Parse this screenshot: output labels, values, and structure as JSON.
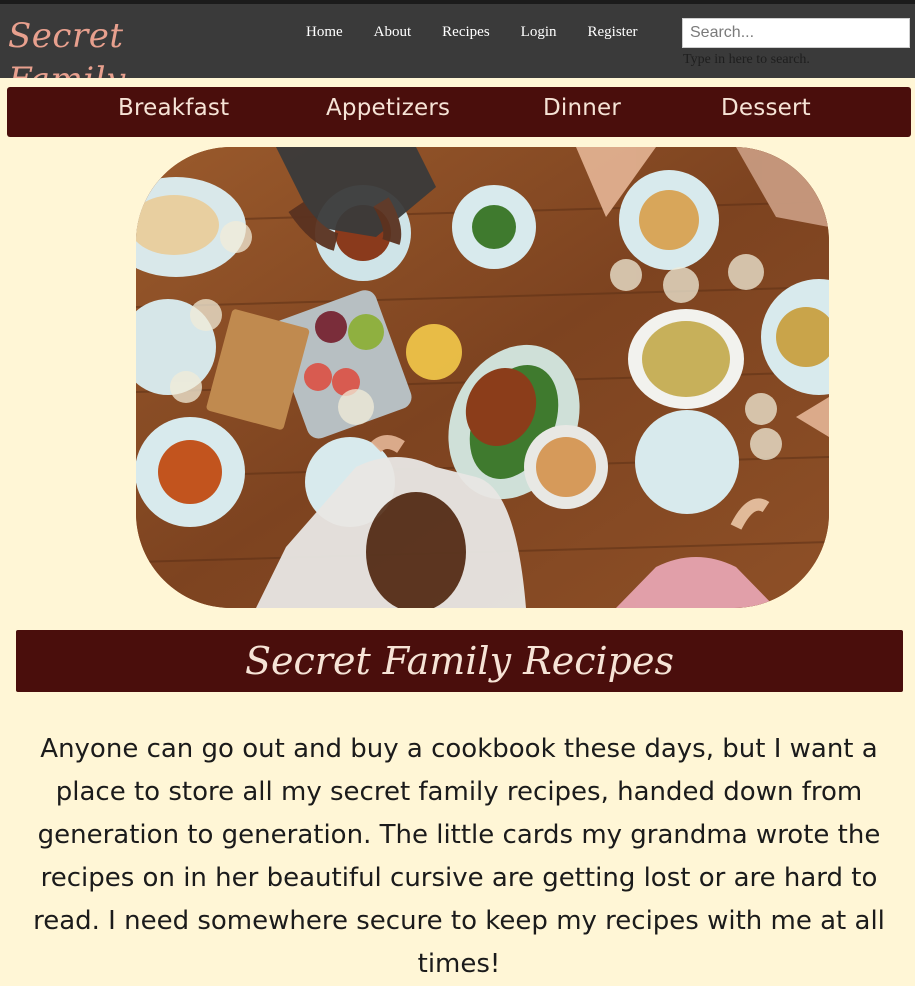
{
  "header": {
    "logo": "Secret Family Recipes",
    "nav": [
      "Home",
      "About",
      "Recipes",
      "Login",
      "Register"
    ],
    "search": {
      "placeholder": "Search...",
      "hint": "Type in here to search."
    }
  },
  "categories": [
    "Breakfast",
    "Appetizers",
    "Dinner",
    "Dessert"
  ],
  "hero": {
    "alt": "Overhead photo of a family dinner table with roast chicken, pasta, salads and wine"
  },
  "main": {
    "title": "Secret Family Recipes",
    "intro": "Anyone can go out and buy a cookbook these days, but I want a place to store all my secret family recipes, handed down from generation to generation. The little cards my grandma wrote the recipes on in her beautiful cursive are getting lost or are hard to read. I need somewhere secure to keep my recipes with me at all times!"
  },
  "colors": {
    "accent": "#4a0e0c",
    "header": "#3a3a3a",
    "background": "#fff6d6",
    "logo": "#e8a08e"
  }
}
